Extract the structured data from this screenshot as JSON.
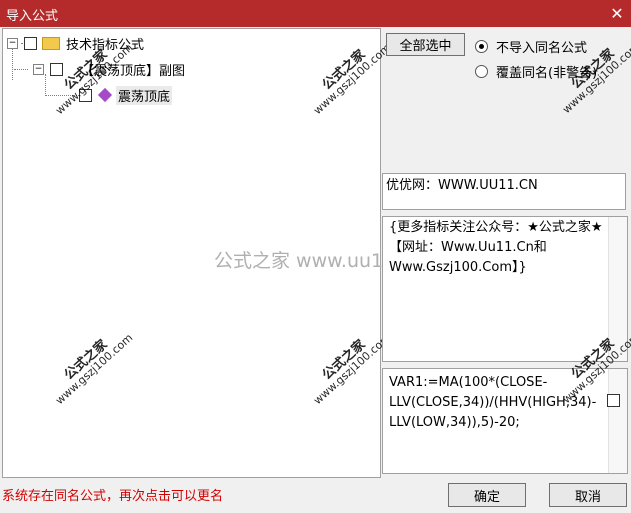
{
  "window": {
    "title": "导入公式",
    "close_glyph": "✕"
  },
  "tree": {
    "root_label": "技术指标公式",
    "group_label": "【震荡顶底】副图",
    "item_label": "震荡顶底",
    "expander_root": "−",
    "expander_group": "−"
  },
  "right": {
    "select_all_label": "全部选中",
    "radio_skip_label": "不导入同名公式",
    "radio_overwrite_label": "覆盖同名(非警告)",
    "site_text": "优优网：WWW.UU11.CN",
    "info_text": "{更多指标关注公众号：★公式之家★【网址：Www.Uu11.Cn和Www.Gszj100.Com】}",
    "formula_text": "VAR1:=MA(100*(CLOSE-LLV(CLOSE,34))/(HHV(HIGH,34)-LLV(LOW,34)),5)-20;"
  },
  "footer": {
    "status": "系统存在同名公式，再次点击可以更名",
    "ok_label": "确定",
    "cancel_label": "取消"
  },
  "watermark": {
    "brand": "公式之家",
    "url": "www.gszj100.com",
    "center_text": "公式之家 www.uu11.cn"
  }
}
